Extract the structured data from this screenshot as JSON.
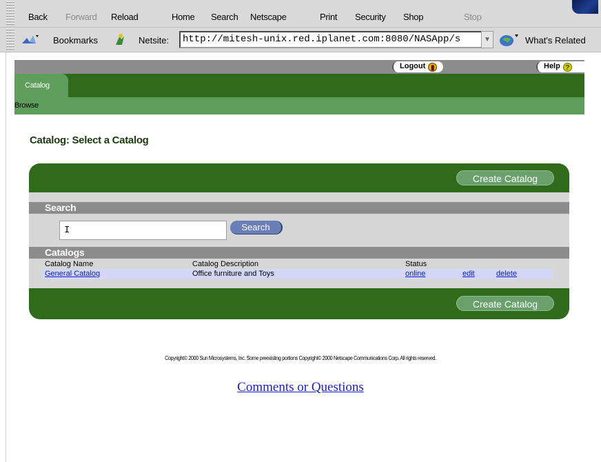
{
  "browser": {
    "nav_buttons": {
      "back": "Back",
      "forward": "Forward",
      "reload": "Reload",
      "home": "Home",
      "search": "Search",
      "netscape": "Netscape",
      "print": "Print",
      "security": "Security",
      "shop": "Shop",
      "stop": "Stop"
    },
    "bookmarks_label": "Bookmarks",
    "netsite_label": "Netsite:",
    "url": "http://mitesh-unix.red.iplanet.com:8080/NASApp/s",
    "related_label": "What's Related"
  },
  "header": {
    "logout_label": "Logout",
    "help_label": "Help",
    "help_glyph": "?"
  },
  "tabs": [
    {
      "label": "Catalog",
      "active": true
    }
  ],
  "subnav": {
    "browse_label": "Browse"
  },
  "main": {
    "title": "Catalog: Select a Catalog",
    "create_catalog_label": "Create Catalog",
    "search": {
      "section_label": "Search",
      "input_value": "I",
      "button_label": "Search"
    },
    "catalogs": {
      "section_label": "Catalogs",
      "columns": [
        "Catalog Name",
        "Catalog Description",
        "Status"
      ],
      "rows": [
        {
          "name": "General Catalog",
          "description": "Office furniture and Toys",
          "status": "online",
          "edit_label": "edit",
          "delete_label": "delete"
        }
      ]
    }
  },
  "footer": {
    "copyright": "Copyright© 2000 Sun Microsystems, Inc. Some preexisting portions Copyright© 2000 Netscape Communications Corp. All rights reserved.",
    "comments_link": "Comments or Questions"
  },
  "colors": {
    "dark_green": "#2f6b1b",
    "light_green": "#5e9e5b",
    "panel_grey": "#d6d6d6",
    "section_grey": "#8c8c8c",
    "row_highlight": "#d3d6f7",
    "link_blue": "#0a1fb8"
  }
}
